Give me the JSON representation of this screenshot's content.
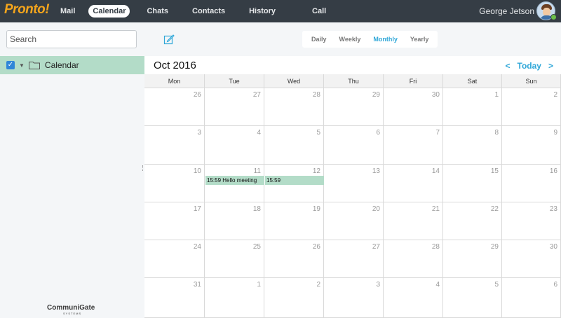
{
  "app": {
    "logo_text": "Pronto!",
    "user_name": "George Jetson"
  },
  "nav": [
    "Mail",
    "Calendar",
    "Chats",
    "Contacts",
    "History",
    "Call"
  ],
  "nav_active": "Calendar",
  "toolbar": {
    "search_placeholder": "Search",
    "views": [
      "Daily",
      "Weekly",
      "Monthly",
      "Yearly"
    ],
    "active_view": "Monthly"
  },
  "sidebar": {
    "calendar_label": "Calendar",
    "calendar_checked": true,
    "brand_text": "CommuniGate",
    "brand_sub": "SYSTEMS"
  },
  "calendar": {
    "month_title": "Oct 2016",
    "prev_label": "<",
    "today_label": "Today",
    "next_label": ">",
    "weekdays": [
      "Mon",
      "Tue",
      "Wed",
      "Thu",
      "Fri",
      "Sat",
      "Sun"
    ],
    "weeks": [
      [
        "26",
        "27",
        "28",
        "29",
        "30",
        "1",
        "2"
      ],
      [
        "3",
        "4",
        "5",
        "6",
        "7",
        "8",
        "9"
      ],
      [
        "10",
        "11",
        "12",
        "13",
        "14",
        "15",
        "16"
      ],
      [
        "17",
        "18",
        "19",
        "20",
        "21",
        "22",
        "23"
      ],
      [
        "24",
        "25",
        "26",
        "27",
        "28",
        "29",
        "30"
      ],
      [
        "31",
        "1",
        "2",
        "3",
        "4",
        "5",
        "6"
      ]
    ],
    "events": [
      {
        "label": "15:59 Hello meeting",
        "week": 2,
        "day": 1
      },
      {
        "label": "15:59",
        "week": 2,
        "day": 2
      }
    ]
  },
  "colors": {
    "topbar": "#353d45",
    "accent": "#2fa7d8",
    "logo": "#f4a51c",
    "event": "#b3dcc8",
    "selection": "#b3dcc8"
  }
}
